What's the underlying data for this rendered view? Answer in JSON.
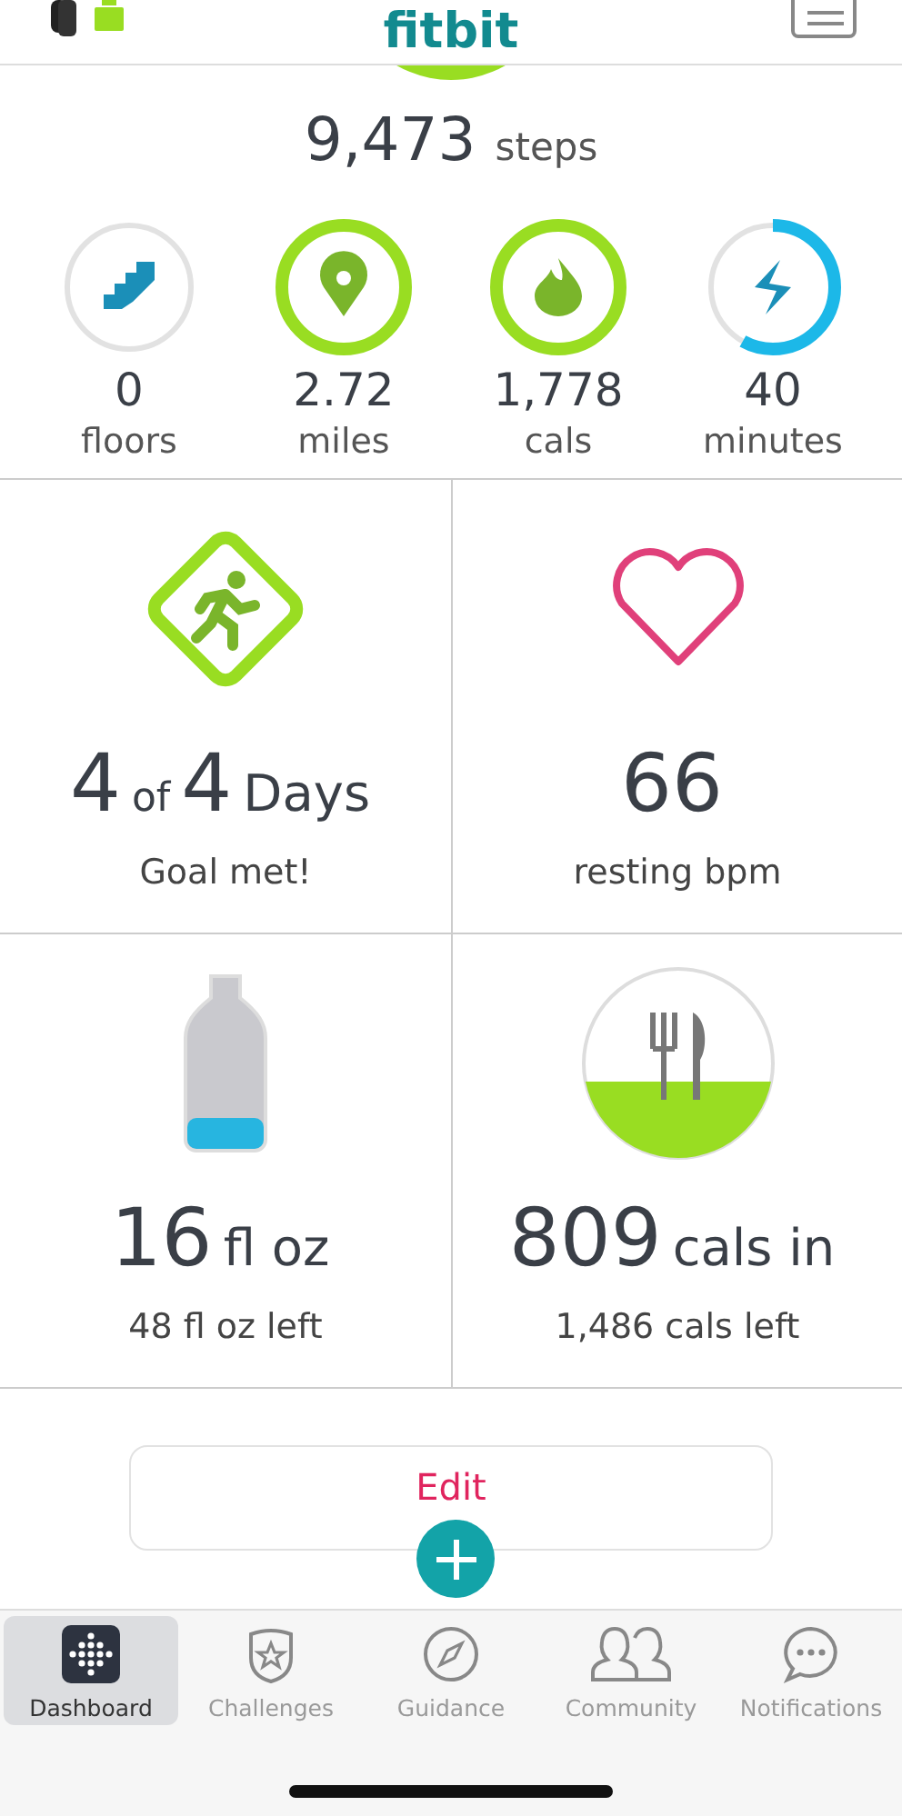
{
  "header": {
    "logo": "fitbit"
  },
  "steps": {
    "value": "9,473",
    "unit": "steps"
  },
  "stats": [
    {
      "kind": "floors",
      "value": "0",
      "label": "floors",
      "color": "#1b9bc4"
    },
    {
      "kind": "distance",
      "value": "2.72",
      "label": "miles",
      "color": "#99dd22"
    },
    {
      "kind": "calories",
      "value": "1,778",
      "label": "cals",
      "color": "#99dd22"
    },
    {
      "kind": "active",
      "value": "40",
      "label": "minutes",
      "color": "#1cb8e8"
    }
  ],
  "tiles": [
    {
      "kind": "exercise",
      "parts": [
        {
          "text": "4",
          "kind": "number"
        },
        {
          "text": "of",
          "kind": "small"
        },
        {
          "text": "4",
          "kind": "number"
        },
        {
          "text": "Days",
          "kind": "unit"
        }
      ],
      "caption": "Goal met!"
    },
    {
      "kind": "heart",
      "parts": [
        {
          "text": "66",
          "kind": "number"
        }
      ],
      "caption": "resting bpm"
    },
    {
      "kind": "water",
      "parts": [
        {
          "text": "16",
          "kind": "number"
        },
        {
          "text": "fl oz",
          "kind": "unit"
        }
      ],
      "caption": "48 fl oz left"
    },
    {
      "kind": "food",
      "parts": [
        {
          "text": "809",
          "kind": "number"
        },
        {
          "text": "cals in",
          "kind": "unit"
        }
      ],
      "caption": "1,486 cals left"
    }
  ],
  "edit_button": "Edit",
  "tabs": [
    {
      "kind": "dashboard",
      "label": "Dashboard",
      "selected": true
    },
    {
      "kind": "challenges",
      "label": "Challenges",
      "selected": false
    },
    {
      "kind": "guidance",
      "label": "Guidance",
      "selected": false
    },
    {
      "kind": "community",
      "label": "Community",
      "selected": false
    },
    {
      "kind": "notifications",
      "label": "Notifications",
      "selected": false
    }
  ]
}
